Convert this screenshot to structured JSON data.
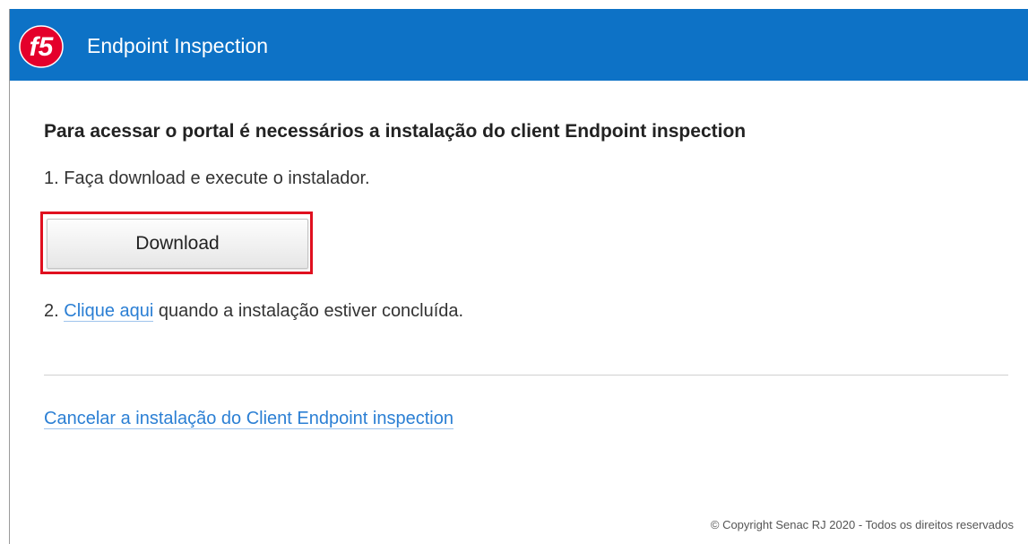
{
  "header": {
    "logo_text": "f5",
    "title": "Endpoint Inspection",
    "background_color": "#0d72c6"
  },
  "main": {
    "heading": "Para acessar o portal é necessários a instalação do client Endpoint inspection",
    "step1": "1. Faça download e execute o instalador.",
    "download_button": "Download",
    "step2_prefix": "2. ",
    "step2_link": "Clique aqui",
    "step2_suffix": " quando a instalação estiver concluída.",
    "cancel_link": "Cancelar a instalação do Client Endpoint inspection",
    "highlight_color": "#e0101f",
    "link_color": "#2b7fd4"
  },
  "footer": {
    "copyright": "© Copyright Senac RJ 2020 - Todos os direitos reservados"
  }
}
